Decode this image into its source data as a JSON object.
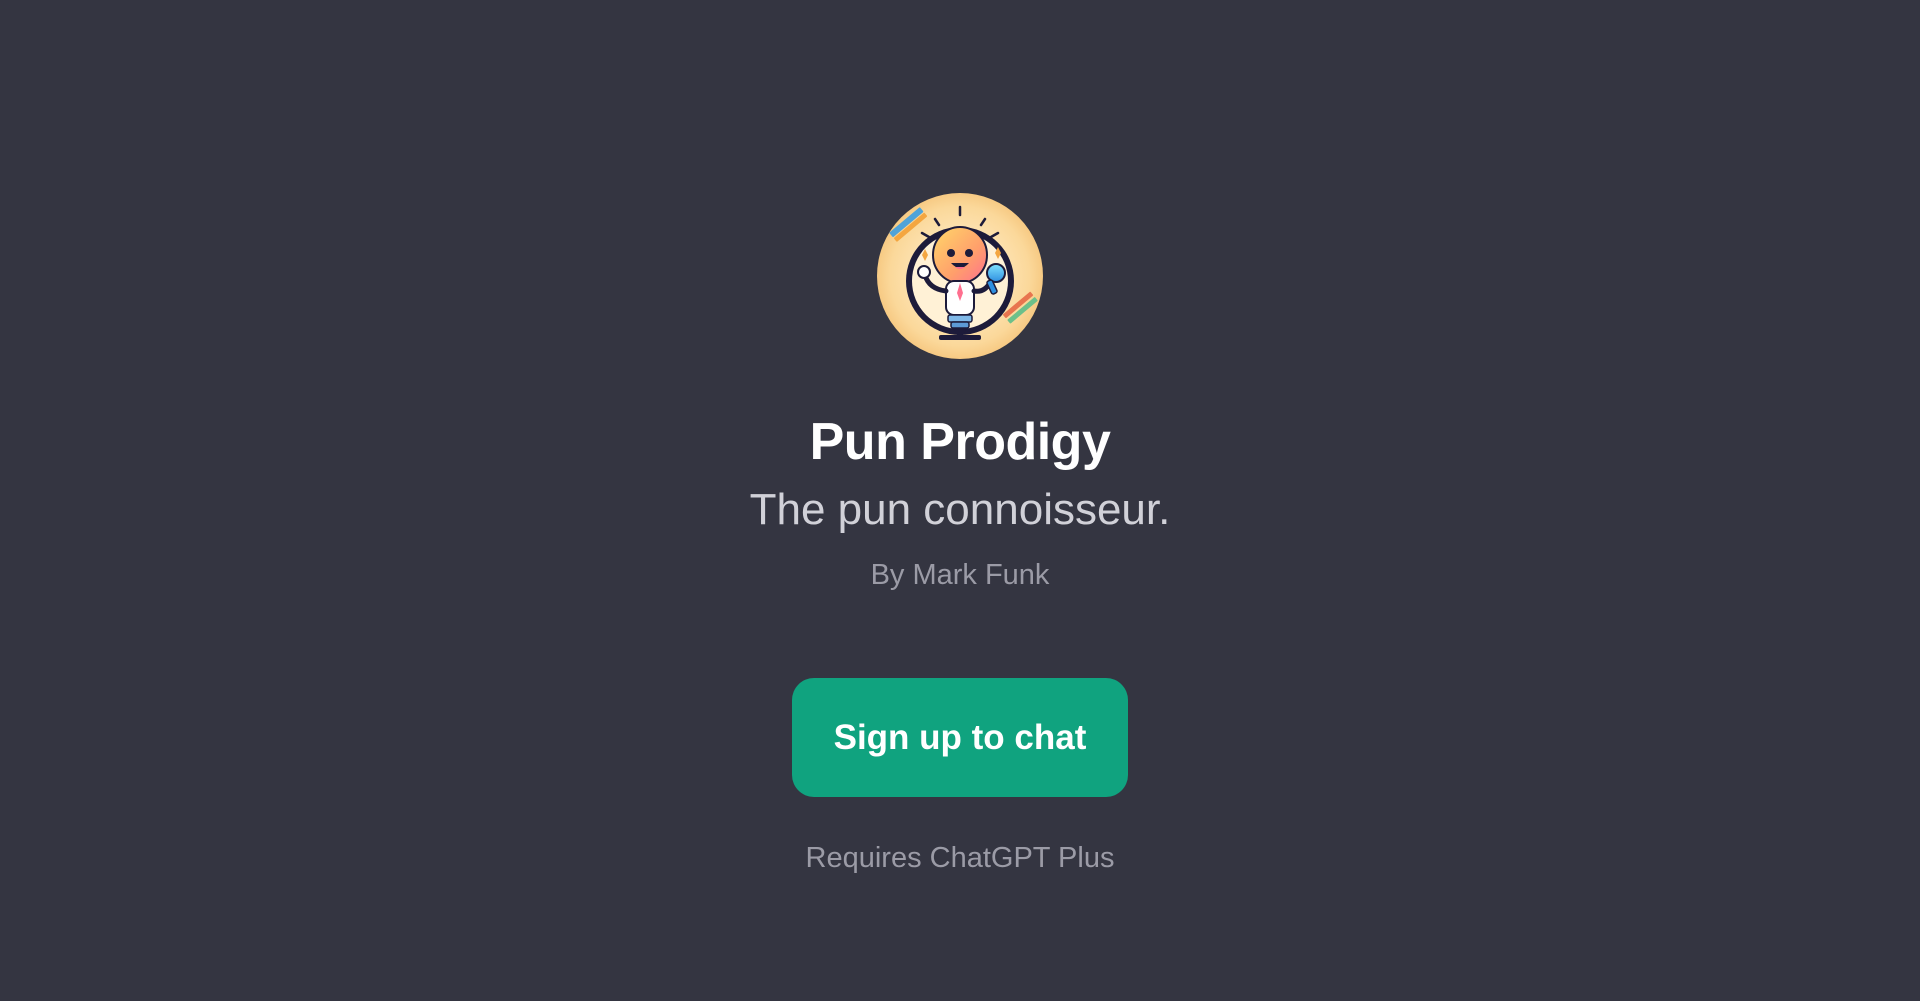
{
  "gpt": {
    "name": "Pun Prodigy",
    "description": "The pun connoisseur.",
    "author": "By Mark Funk",
    "avatar_icon": "lightbulb-mascot-icon"
  },
  "cta": {
    "label": "Sign up to chat"
  },
  "footer": {
    "requirement": "Requires ChatGPT Plus"
  },
  "colors": {
    "background": "#343541",
    "accent": "#10a37f",
    "title": "#ffffff",
    "subtitle": "#d1d1d8",
    "muted": "#9b9ba6"
  }
}
